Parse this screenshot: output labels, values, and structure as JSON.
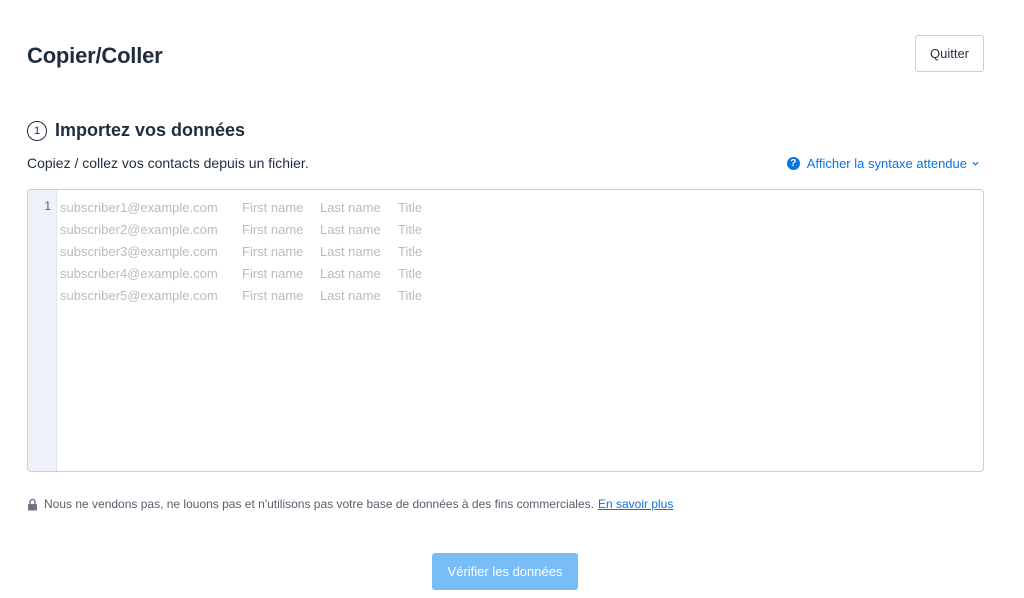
{
  "header": {
    "title": "Copier/Coller",
    "quit_label": "Quitter"
  },
  "step": {
    "number": "1",
    "title": "Importez vos données",
    "instructions": "Copiez / collez vos contacts depuis un fichier.",
    "syntax_link": "Afficher la syntaxe attendue"
  },
  "editor": {
    "line_number": "1",
    "placeholder_rows": [
      [
        "subscriber1@example.com",
        "First name",
        "Last name",
        "Title"
      ],
      [
        "subscriber2@example.com",
        "First name",
        "Last name",
        "Title"
      ],
      [
        "subscriber3@example.com",
        "First name",
        "Last name",
        "Title"
      ],
      [
        "subscriber4@example.com",
        "First name",
        "Last name",
        "Title"
      ],
      [
        "subscriber5@example.com",
        "First name",
        "Last name",
        "Title"
      ]
    ]
  },
  "footer": {
    "privacy_text": "Nous ne vendons pas, ne louons pas et n'utilisons pas votre base de données à des fins commerciales.",
    "learn_more": "En savoir plus",
    "verify_label": "Vérifier les données"
  },
  "icons": {
    "help": "help-circle-icon",
    "chevron": "chevron-down-icon",
    "lock": "lock-icon"
  },
  "colors": {
    "accent": "#0b74de",
    "primary_button_disabled": "#78bdf6",
    "placeholder_text": "#b5bcc6"
  }
}
